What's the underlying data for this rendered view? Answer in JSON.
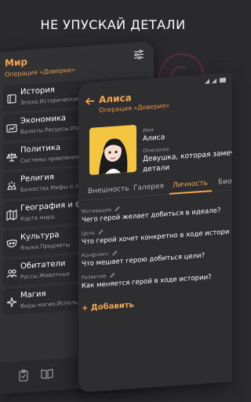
{
  "headline": "НЕ УПУСКАЙ ДЕТАЛИ",
  "colors": {
    "accent": "#f3a64f",
    "background": "#2a2a2d",
    "panel": "#2e2e30"
  },
  "world_screen": {
    "title": "Мир",
    "subtitle": "Операция «Доверие»",
    "filter_icon": "tune-icon",
    "items": [
      {
        "icon": "book-icon",
        "title": "История",
        "desc": "Эпоха.Исторические события"
      },
      {
        "icon": "chart-icon",
        "title": "Экономика",
        "desc": "Валюты.Ресурсы.Изве"
      },
      {
        "icon": "scales-icon",
        "title": "Политика",
        "desc": "Системы правления.Зако"
      },
      {
        "icon": "sun-icon",
        "title": "Религия",
        "desc": "Божества.Мифы и ле"
      },
      {
        "icon": "map-icon",
        "title": "География и ф",
        "desc": "Карта мира."
      },
      {
        "icon": "mask-icon",
        "title": "Культура",
        "desc": "Языки.Предметы"
      },
      {
        "icon": "people-icon",
        "title": "Обитатели",
        "desc": "Рассы.Животные"
      },
      {
        "icon": "magic-icon",
        "title": "Магия",
        "desc": "Виды магии.Использ"
      }
    ],
    "bottom_icons": [
      "clipboard-icon",
      "open-book-icon"
    ]
  },
  "character_screen": {
    "title": "Алиса",
    "subtitle": "Операция «Доверие»",
    "name_label": "Имя",
    "name_value": "Алиса",
    "description_label": "Описание",
    "description_value_line1": "Девушка, которая замеча",
    "description_value_line2": "детали",
    "tabs": [
      {
        "label": "Внешность",
        "active": false
      },
      {
        "label": "Галерея",
        "active": false
      },
      {
        "label": "Личность",
        "active": true
      },
      {
        "label": "Био",
        "active": false
      }
    ],
    "fields": [
      {
        "label": "Мотивация",
        "value": "Чего герой желает добиться в идеале?"
      },
      {
        "label": "Цель",
        "value": "Что герой хочет конкретно в ходе истори"
      },
      {
        "label": "Конфликт",
        "value": "Что мешает герою добиться цели?"
      },
      {
        "label": "Развитие",
        "value": "Как меняется герой в ходе истории?"
      }
    ],
    "add_label": "+ Добавить"
  }
}
